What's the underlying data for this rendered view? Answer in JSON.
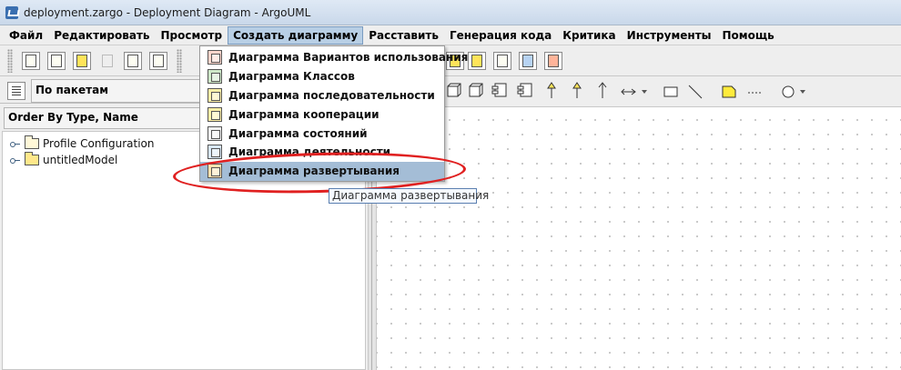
{
  "window": {
    "title": "deployment.zargo - Deployment Diagram - ArgoUML"
  },
  "menubar": {
    "items": [
      {
        "label": "Файл"
      },
      {
        "label": "Редактировать"
      },
      {
        "label": "Просмотр"
      },
      {
        "label": "Создать диаграмму"
      },
      {
        "label": "Расставить"
      },
      {
        "label": "Генерация кода"
      },
      {
        "label": "Критика"
      },
      {
        "label": "Инструменты"
      },
      {
        "label": "Помощь"
      }
    ],
    "active_index": 3
  },
  "create_diagram_menu": {
    "items": [
      {
        "label": "Диаграмма Вариантов использования",
        "icon": "usecase-diagram-icon"
      },
      {
        "label": "Диаграмма Классов",
        "icon": "class-diagram-icon"
      },
      {
        "label": "Диаграмма последовательности",
        "icon": "sequence-diagram-icon"
      },
      {
        "label": "Диаграмма кооперации",
        "icon": "collaboration-diagram-icon"
      },
      {
        "label": "Диаграмма состояний",
        "icon": "statechart-diagram-icon"
      },
      {
        "label": "Диаграмма деятельности",
        "icon": "activity-diagram-icon"
      },
      {
        "label": "Диаграмма развертывания",
        "icon": "deployment-diagram-icon"
      }
    ],
    "highlighted_index": 6
  },
  "tooltip": {
    "text": "Диаграмма развертывания"
  },
  "explorer": {
    "perspective": "По пакетам",
    "order": "Order By Type, Name",
    "tree": [
      {
        "label": "Profile Configuration",
        "icon": "folder-icon"
      },
      {
        "label": "untitledModel",
        "icon": "model-icon"
      }
    ]
  },
  "annotation": {
    "color": "#e02020"
  }
}
